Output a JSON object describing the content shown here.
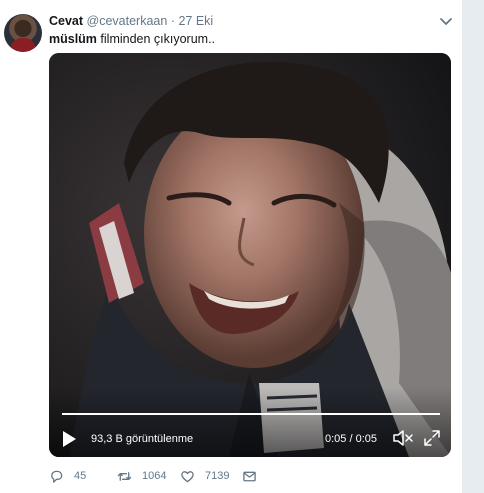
{
  "tweet": {
    "author_name": "Cevat",
    "handle": "@cevaterkaan",
    "separator": "·",
    "date": "27 Eki",
    "text_bold": "müslüm",
    "text_rest": " filminden çıkıyorum.."
  },
  "video": {
    "views": "93,3 B görüntülenme",
    "time": "0:05 / 0:05",
    "progress": 1.0
  },
  "actions": {
    "reply_count": "45",
    "retweet_count": "1064",
    "like_count": "7139"
  },
  "colors": {
    "text": "#14171a",
    "muted": "#657786",
    "background": "#e6ecf0"
  }
}
